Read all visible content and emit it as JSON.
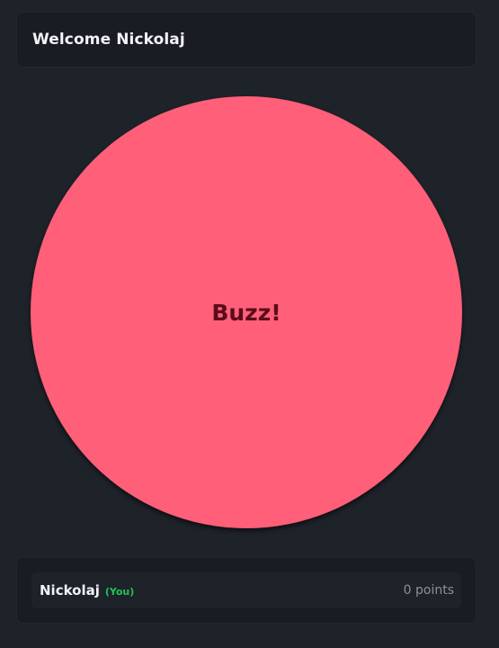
{
  "header": {
    "title": "Welcome Nickolaj"
  },
  "buzzer": {
    "label": "Buzz!",
    "color": "#ff5f78",
    "text_color": "#5a0c1b"
  },
  "players": [
    {
      "name": "Nickolaj",
      "badge": "(You)",
      "points": "0 points"
    }
  ],
  "colors": {
    "background": "#1e2229",
    "card": "#191c22",
    "badge_green": "#1fc45a"
  }
}
